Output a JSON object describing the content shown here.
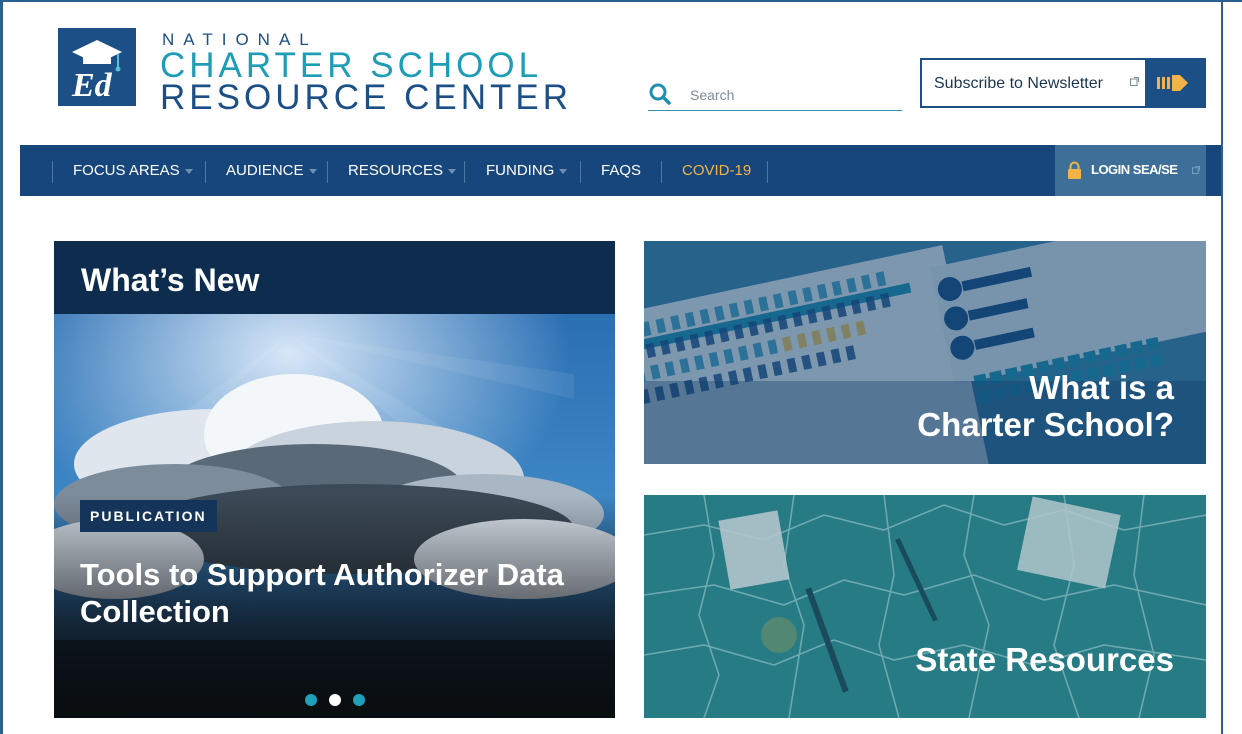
{
  "brand": {
    "logo_mark": "Ed",
    "line1": "NATIONAL",
    "line2": "CHARTER SCHOOL",
    "line3": "RESOURCE CENTER",
    "colors": {
      "navy": "#1b4f86",
      "teal": "#1e9db6",
      "nav": "#17467c",
      "accent": "#f2b349"
    }
  },
  "search": {
    "placeholder": "Search",
    "value": ""
  },
  "newsletter": {
    "label": "Subscribe to Newsletter"
  },
  "nav": {
    "items": [
      {
        "label": "FOCUS AREAS",
        "dropdown": true
      },
      {
        "label": "AUDIENCE",
        "dropdown": true
      },
      {
        "label": "RESOURCES",
        "dropdown": true
      },
      {
        "label": "FUNDING",
        "dropdown": true
      },
      {
        "label": "FAQS",
        "dropdown": false
      },
      {
        "label": "COVID-19",
        "dropdown": false,
        "highlight": true
      }
    ],
    "login_label": "LOGIN SEA/SE"
  },
  "whats_new": {
    "heading": "What’s New",
    "badge": "PUBLICATION",
    "headline": "Tools to Support Authorizer Data Collection",
    "slides_total": 3,
    "active_slide": 2
  },
  "cards": [
    {
      "title_line1": "What is a",
      "title_line2": "Charter School?"
    },
    {
      "title": "State Resources"
    }
  ]
}
